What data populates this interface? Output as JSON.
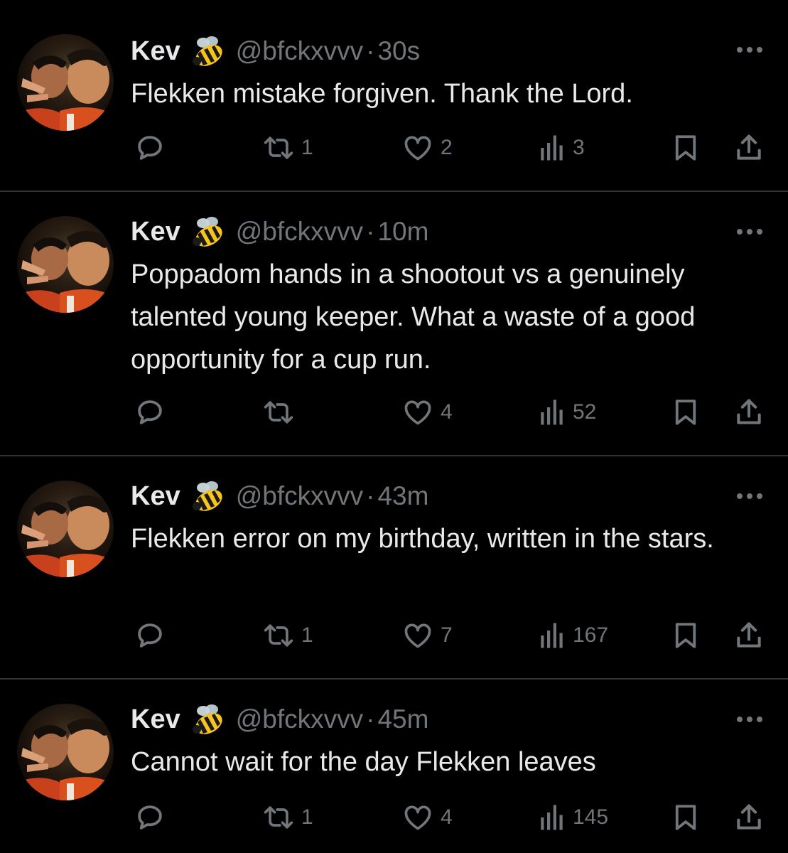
{
  "colors": {
    "background": "#000000",
    "text_primary": "#e7e9ea",
    "text_secondary": "#71767b",
    "divider": "#2f3336"
  },
  "tweets": [
    {
      "name": "Kev",
      "badge_icon": "bee-emoji",
      "handle": "@bfckxvvv",
      "separator": "·",
      "time": "30s",
      "text": "Flekken mistake forgiven. Thank the Lord.",
      "replies": "",
      "retweets": "1",
      "likes": "2",
      "views": "3"
    },
    {
      "name": "Kev",
      "badge_icon": "bee-emoji",
      "handle": "@bfckxvvv",
      "separator": "·",
      "time": "10m",
      "text": "Poppadom hands in a shootout vs a genuinely talented young keeper. What a waste of a good opportunity for a cup run.",
      "replies": "",
      "retweets": "",
      "likes": "4",
      "views": "52"
    },
    {
      "name": "Kev",
      "badge_icon": "bee-emoji",
      "handle": "@bfckxvvv",
      "separator": "·",
      "time": "43m",
      "text": "Flekken error on my birthday, written in the stars.",
      "replies": "",
      "retweets": "1",
      "likes": "7",
      "views": "167"
    },
    {
      "name": "Kev",
      "badge_icon": "bee-emoji",
      "handle": "@bfckxvvv",
      "separator": "·",
      "time": "45m",
      "text": "Cannot wait for the day Flekken leaves",
      "replies": "",
      "retweets": "1",
      "likes": "4",
      "views": "145"
    }
  ]
}
